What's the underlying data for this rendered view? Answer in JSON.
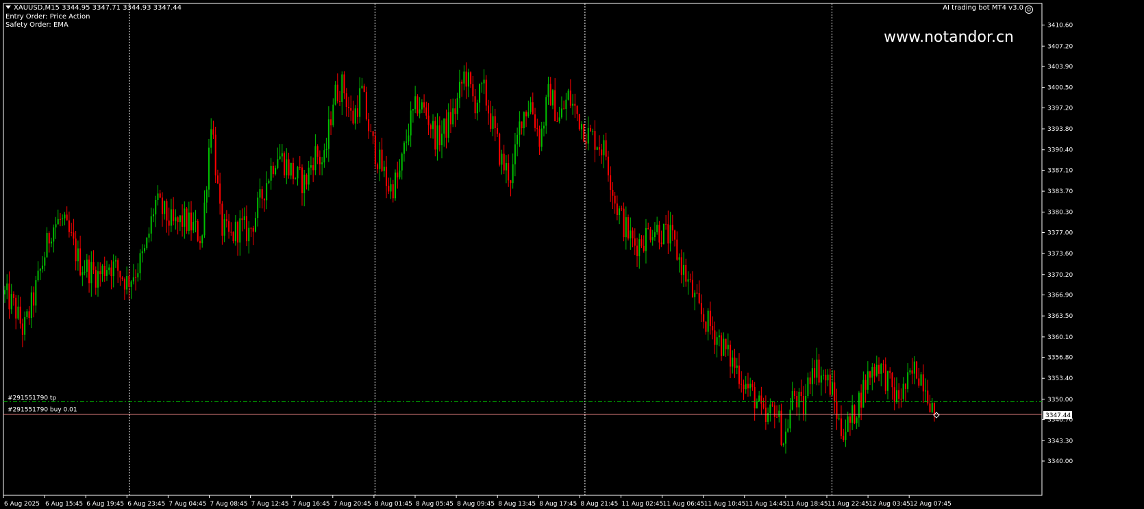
{
  "header": {
    "symbol_line": "XAUUSD,M15  3344.95 3347.71 3344.93 3347.44",
    "entry_order": "Entry Order: Price Action",
    "safety_order": "Safety Order: EMA",
    "ea_name": "AI trading bot MT4 v3.0",
    "watermark": "www.notandor.cn"
  },
  "orders": {
    "tp_label": "#291551790 tp",
    "buy_label": "#291551790 buy 0.01",
    "tp_price": 3349.6,
    "buy_price": 3347.6
  },
  "current_price_label": "3347.44",
  "colors": {
    "background": "#000000",
    "bull": "#00c000",
    "bear": "#ff0000",
    "tp_line": "#00c000",
    "buy_line": "#ff9090",
    "grid": "#ffffff"
  },
  "chart_data": {
    "type": "candlestick",
    "symbol": "XAUUSD",
    "timeframe": "M15",
    "ylim": [
      3340.0,
      3412.0
    ],
    "y_ticks": [
      "3410.60",
      "3407.20",
      "3403.90",
      "3400.50",
      "3397.20",
      "3393.80",
      "3390.40",
      "3387.10",
      "3383.70",
      "3380.30",
      "3377.00",
      "3373.60",
      "3370.20",
      "3366.90",
      "3363.50",
      "3360.10",
      "3356.80",
      "3353.40",
      "3350.00",
      "3346.70",
      "3343.30",
      "3340.00"
    ],
    "x_labels": [
      "6 Aug 2025",
      "6 Aug 15:45",
      "6 Aug 19:45",
      "6 Aug 23:45",
      "7 Aug 04:45",
      "7 Aug 08:45",
      "7 Aug 12:45",
      "7 Aug 16:45",
      "7 Aug 20:45",
      "8 Aug 01:45",
      "8 Aug 05:45",
      "8 Aug 09:45",
      "8 Aug 13:45",
      "8 Aug 17:45",
      "8 Aug 21:45",
      "11 Aug 02:45",
      "11 Aug 06:45",
      "11 Aug 10:45",
      "11 Aug 14:45",
      "11 Aug 18:45",
      "11 Aug 22:45",
      "12 Aug 03:45",
      "12 Aug 07:45"
    ],
    "separators": [
      "6 Aug 23:45",
      "8 Aug 01:45",
      "8 Aug 21:45",
      "11 Aug 22:45"
    ],
    "close_path": [
      3367,
      3365,
      3361,
      3366,
      3372,
      3378,
      3379,
      3376,
      3372,
      3371,
      3370,
      3372,
      3371,
      3369,
      3371,
      3374,
      3382,
      3380,
      3378,
      3379,
      3378,
      3376,
      3396,
      3378,
      3376,
      3378,
      3377,
      3381,
      3386,
      3390,
      3388,
      3386,
      3385,
      3390,
      3388,
      3399,
      3401,
      3395,
      3400,
      3392,
      3388,
      3384,
      3386,
      3394,
      3398,
      3396,
      3392,
      3394,
      3397,
      3403,
      3398,
      3400,
      3394,
      3388,
      3386,
      3396,
      3398,
      3392,
      3400,
      3395,
      3399,
      3396,
      3393,
      3392,
      3390,
      3382,
      3378,
      3375,
      3376,
      3378,
      3377,
      3376,
      3372,
      3368,
      3364,
      3362,
      3360,
      3357,
      3355,
      3352,
      3350,
      3346,
      3349,
      3343,
      3351,
      3348,
      3356,
      3354,
      3352,
      3345,
      3346,
      3350,
      3354,
      3356,
      3353,
      3350,
      3352,
      3355,
      3353,
      3347.44
    ]
  }
}
